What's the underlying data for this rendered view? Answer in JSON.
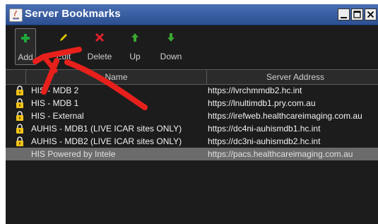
{
  "window": {
    "title": "Server Bookmarks",
    "controls": [
      "minimize",
      "maximize",
      "close"
    ]
  },
  "toolbar": {
    "buttons": [
      {
        "label": "Add",
        "icon": "plus-icon",
        "color": "#1fa83a"
      },
      {
        "label": "Edit",
        "icon": "pencil-icon",
        "color": "#e0c300"
      },
      {
        "label": "Delete",
        "icon": "x-icon",
        "color": "#e0202a"
      },
      {
        "label": "Up",
        "icon": "arrow-up-icon",
        "color": "#3aa832"
      },
      {
        "label": "Down",
        "icon": "arrow-down-icon",
        "color": "#3aa832"
      }
    ]
  },
  "table": {
    "columns": [
      "Name",
      "Server Address"
    ],
    "rows": [
      {
        "locked": true,
        "name": "HIS - MDB 2",
        "address": "https://lvrchmmdb2.hc.int"
      },
      {
        "locked": true,
        "name": "HIS - MDB 1",
        "address": "https://lnultimdb1.pry.com.au"
      },
      {
        "locked": true,
        "name": "HIS - External",
        "address": "https://irefweb.healthcareimaging.com.au"
      },
      {
        "locked": true,
        "name": "AUHIS - MDB1 (LIVE ICAR sites ONLY)",
        "address": "https://dc4ni-auhismdb1.hc.int"
      },
      {
        "locked": true,
        "name": "AUHIS - MDB2 (LIVE ICAR sites ONLY)",
        "address": "https://dc3ni-auhismdb2.hc.int"
      },
      {
        "locked": false,
        "name": "HIS Powered by Intele",
        "address": "https://pacs.healthcareimaging.com.au",
        "selected": true
      }
    ]
  },
  "annotation": {
    "color": "#e8201c",
    "shape": "red-arrow",
    "points_to": "Add"
  }
}
